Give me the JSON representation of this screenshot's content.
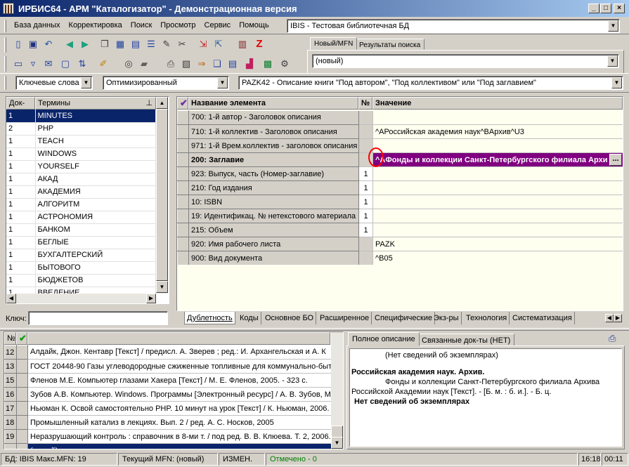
{
  "window": {
    "title": "ИРБИС64 - АРМ \"Каталогизатор\" - Демонстрационная версия"
  },
  "menu": [
    "База данных",
    "Корректировка",
    "Поиск",
    "Просмотр",
    "Сервис",
    "Помощь"
  ],
  "database": {
    "selected": "IBIS - Тестовая библиотечная БД"
  },
  "record_tabs": [
    "Новый/MFN",
    "Результаты поиска"
  ],
  "record_select": {
    "value": "(новый)"
  },
  "search_bar": {
    "mode": "Ключевые слова",
    "optimization": "Оптимизированный",
    "worksheet": "PAZK42 - Описание книги \"Под автором\", \"Под коллективом\" или \"Под заглавием\""
  },
  "terms": {
    "col_count": "Док-ов",
    "col_term": "Термины",
    "rows": [
      {
        "count": "1",
        "term": "MINUTES"
      },
      {
        "count": "2",
        "term": "PHP"
      },
      {
        "count": "1",
        "term": "TEACH"
      },
      {
        "count": "1",
        "term": "WINDOWS"
      },
      {
        "count": "1",
        "term": "YOURSELF"
      },
      {
        "count": "1",
        "term": "АКАД"
      },
      {
        "count": "1",
        "term": "АКАДЕМИЯ"
      },
      {
        "count": "1",
        "term": "АЛГОРИТМ"
      },
      {
        "count": "1",
        "term": "АСТРОНОМИЯ"
      },
      {
        "count": "1",
        "term": "БАНКОМ"
      },
      {
        "count": "1",
        "term": "БЕГЛЫЕ"
      },
      {
        "count": "1",
        "term": "БУХГАЛТЕРСКИЙ"
      },
      {
        "count": "1",
        "term": "БЫТОВОГО"
      },
      {
        "count": "1",
        "term": "БЮДЖЕТОВ"
      },
      {
        "count": "1",
        "term": "ВВЕДЕНИЕ"
      }
    ],
    "key_label": "Ключ:"
  },
  "fields": {
    "col_name": "Название элемента",
    "col_num": "№",
    "col_value": "Значение",
    "rows": [
      {
        "name": "700: 1-й  автор - Заголовок описания",
        "num": "",
        "value": ""
      },
      {
        "name": "710: 1-й коллектив - Заголовок описания",
        "num": "",
        "value": "^AРоссийская академия наук^BАрхив^U3"
      },
      {
        "name": "971: 1-й Врем.коллектив - заголовок описания",
        "num": "",
        "value": ""
      },
      {
        "name": "200: Заглавие",
        "num": "",
        "value": "^AФонды и коллекции Санкт-Петербургского филиала Архи"
      },
      {
        "name": "923: Выпуск, часть (Номер-заглавие)",
        "num": "1",
        "value": ""
      },
      {
        "name": "210: Год издания",
        "num": "1",
        "value": ""
      },
      {
        "name": "10: ISBN",
        "num": "1",
        "value": ""
      },
      {
        "name": "19: Идентификац. № нетекстового материала",
        "num": "1",
        "value": ""
      },
      {
        "name": "215: Объем",
        "num": "1",
        "value": ""
      },
      {
        "name": "920: Имя рабочего листа",
        "num": "",
        "value": "PAZK"
      },
      {
        "name": "900: Вид документа",
        "num": "",
        "value": "^B05"
      }
    ],
    "edit_button": "..."
  },
  "bottom_tabs": [
    "Дублетность",
    "Коды",
    "Основное БО",
    "Расширенное",
    "Специфические",
    "Экз-ры",
    "Технология",
    "Систематизация"
  ],
  "records": {
    "col_num": "№",
    "rows": [
      {
        "num": "12",
        "text": "Алдайк, Джон. Кентавр [Текст] / предисл. А. Зверев ; ред.: И. Архангельская и А. К"
      },
      {
        "num": "13",
        "text": "ГОСТ 20448-90 Газы углеводородные сжиженные топливные для коммунально-быт"
      },
      {
        "num": "15",
        "text": "Фленов М.Е. Компьютер глазами Хакера [Текст] / М. Е. Фленов, 2005. - 323 с."
      },
      {
        "num": "16",
        "text": "Зубов А.В. Компьютер. Windows. Программы [Электронный ресурс] / А. В. Зубов, М"
      },
      {
        "num": "17",
        "text": "Ньюман К. Освой самостоятельно PHP. 10 минут на урок [Текст] / К. Ньюман, 2006."
      },
      {
        "num": "18",
        "text": "Промышленный катализ в лекциях. Вып. 2 / ред. А. С. Носков, 2005"
      },
      {
        "num": "19",
        "text": "Неразрушающий контроль : справочник в 8-ми т. / под ред. В. В. Клюева. Т. 2, 2006."
      }
    ],
    "new_row": "(новый)"
  },
  "description": {
    "tabs": [
      "Полное описание",
      "Связанные док-ты (НЕТ)"
    ],
    "line1": "(Нет сведений об экземплярах)",
    "heading": "Российская академия наук. Архив.",
    "body_indent": "Фонды и коллекции Санкт-Петербургского филиала Архива",
    "body_rest": "Российской Академии наук [Текст]. - [Б. м. : б. и.]. - Б. ц.",
    "footer": "Нет сведений об экземплярах"
  },
  "status": {
    "db": "БД: IBIS Макс.MFN: 19",
    "mfn": "Текущий MFN: (новый)",
    "changed": "ИЗМЕН.",
    "marked": "Отмечено - 0",
    "time": "16:18",
    "elapsed": "00:11"
  },
  "colors": {
    "title_start": "#0a246a",
    "title_end": "#a6caf0",
    "selection": "#0a246a",
    "field_selected": "#800080",
    "marked": "#008000",
    "highlight_circle": "#ff0000"
  }
}
